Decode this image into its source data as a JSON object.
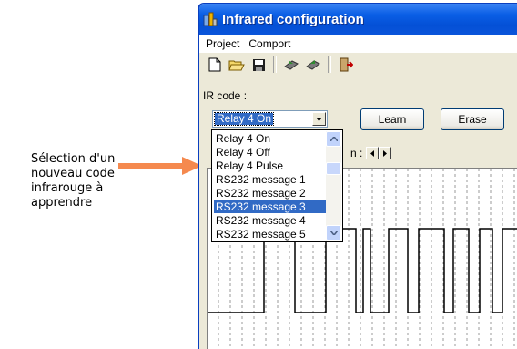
{
  "annotation": {
    "lines": [
      "Sélection d'un",
      "nouveau code",
      "infrarouge à",
      "apprendre"
    ],
    "arrow_color": "#f5894e"
  },
  "window": {
    "title": "Infrared configuration",
    "menu": [
      "Project",
      "Comport"
    ],
    "toolbar_icons": [
      "new-file-icon",
      "open-folder-icon",
      "save-icon",
      "upload-icon",
      "download-icon",
      "exit-icon"
    ],
    "ircode_label": "IR code :",
    "ircode_value": "Relay 4 On",
    "learn_label": "Learn",
    "erase_label": "Erase",
    "partial_label": "n :"
  },
  "dropdown": {
    "items": [
      "Relay 4 On",
      "Relay 4 Off",
      "Relay 4 Pulse",
      "RS232 message 1",
      "RS232 message 2",
      "RS232 message 3",
      "RS232 message 4",
      "RS232 message 5"
    ],
    "selected_index": 5
  },
  "colors": {
    "titlebar": "#0a5fe6",
    "selection": "#316ac5"
  }
}
